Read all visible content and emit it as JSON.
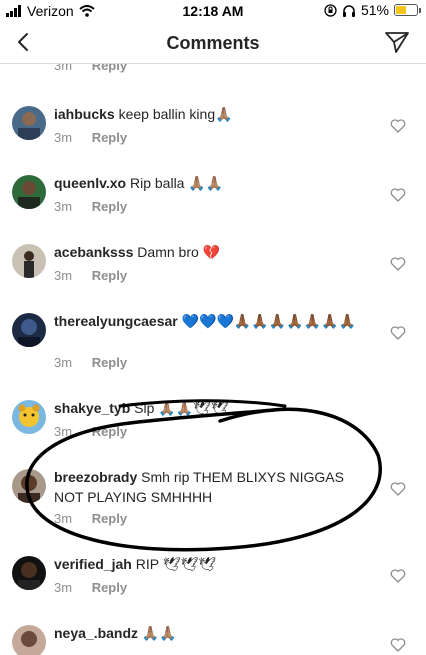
{
  "status_bar": {
    "carrier": "Verizon",
    "time": "12:18 AM",
    "battery": "51%",
    "battery_level": 0.51
  },
  "header": {
    "title": "Comments"
  },
  "top_partial": {
    "time": "3m",
    "reply": "Reply"
  },
  "comments": [
    {
      "username": "iahbucks",
      "text": "keep ballin king🙏🏽",
      "time": "3m",
      "reply": "Reply"
    },
    {
      "username": "queenlv.xo",
      "text": "Rip balla 🙏🏽🙏🏽",
      "time": "3m",
      "reply": "Reply"
    },
    {
      "username": "acebanksss",
      "text": "Damn bro 💔",
      "time": "3m",
      "reply": "Reply"
    },
    {
      "username": "therealyungcaesar",
      "text": "💙💙💙🙏🏾🙏🏾🙏🏾🙏🏾🙏🏾🙏🏾🙏🏾",
      "time": "3m",
      "reply": "Reply"
    },
    {
      "username": "shakye_tyb",
      "text": "Slp 🙏🏽🙏🏽🕊🕊",
      "time": "3m",
      "reply": "Reply"
    },
    {
      "username": "breezobrady",
      "text": "Smh rip THEM BLIXYS NIGGAS NOT PLAYING SMHHHH",
      "time": "3m",
      "reply": "Reply"
    },
    {
      "username": "verified_jah",
      "text": "RIP 🕊🕊🕊",
      "time": "3m",
      "reply": "Reply"
    },
    {
      "username": "neya_.bandz",
      "text": "🙏🏽🙏🏽",
      "time": "",
      "reply": ""
    }
  ]
}
